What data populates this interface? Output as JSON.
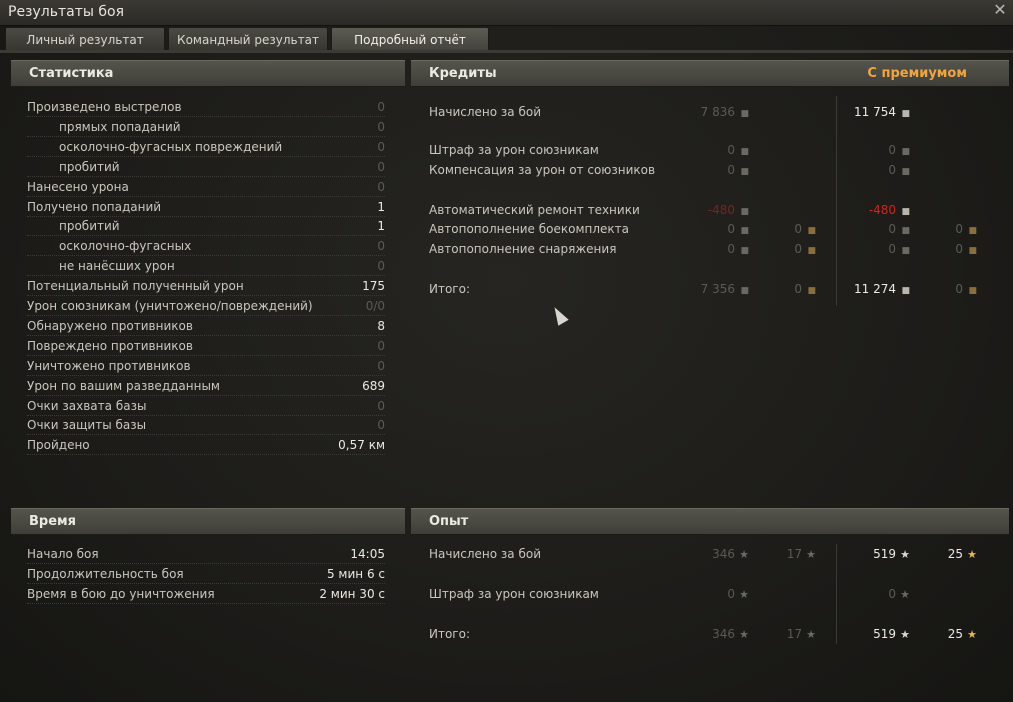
{
  "window": {
    "title": "Результаты боя"
  },
  "tabs": [
    "Личный результат",
    "Командный результат",
    "Подробный отчёт"
  ],
  "stats": {
    "header": "Статистика",
    "rows": [
      {
        "label": "Произведено выстрелов",
        "value": "0",
        "indent": false,
        "dim": true
      },
      {
        "label": "прямых попаданий",
        "value": "0",
        "indent": true,
        "dim": true
      },
      {
        "label": "осколочно-фугасных повреждений",
        "value": "0",
        "indent": true,
        "dim": true
      },
      {
        "label": "пробитий",
        "value": "0",
        "indent": true,
        "dim": true
      },
      {
        "label": "Нанесено урона",
        "value": "0",
        "indent": false,
        "dim": true
      },
      {
        "label": "Получено попаданий",
        "value": "1",
        "indent": false,
        "dim": false
      },
      {
        "label": "пробитий",
        "value": "1",
        "indent": true,
        "dim": false
      },
      {
        "label": "осколочно-фугасных",
        "value": "0",
        "indent": true,
        "dim": true
      },
      {
        "label": "не нанёсших урон",
        "value": "0",
        "indent": true,
        "dim": true
      },
      {
        "label": "Потенциальный полученный урон",
        "value": "175",
        "indent": false,
        "dim": false
      },
      {
        "label": "Урон союзникам (уничтожено/повреждений)",
        "value": "0/0",
        "indent": false,
        "dim": true
      },
      {
        "label": "Обнаружено противников",
        "value": "8",
        "indent": false,
        "dim": false
      },
      {
        "label": "Повреждено противников",
        "value": "0",
        "indent": false,
        "dim": true
      },
      {
        "label": "Уничтожено противников",
        "value": "0",
        "indent": false,
        "dim": true
      },
      {
        "label": "Урон по вашим разведданным",
        "value": "689",
        "indent": false,
        "dim": false
      },
      {
        "label": "Очки захвата базы",
        "value": "0",
        "indent": false,
        "dim": true
      },
      {
        "label": "Очки защиты базы",
        "value": "0",
        "indent": false,
        "dim": true
      },
      {
        "label": "Пройдено",
        "value": "0,57 км",
        "indent": false,
        "dim": false
      }
    ]
  },
  "credits": {
    "header": "Кредиты",
    "premium_label": "С премиумом",
    "rows": [
      {
        "label": "Начислено за бой",
        "std": "7 836",
        "std_gold": "",
        "prem": "11 754",
        "prem_gold": "",
        "style": "normal",
        "prem_bright": true,
        "std_red": false
      },
      {
        "label": "Штраф за урон союзникам",
        "std": "0",
        "std_gold": "",
        "prem": "0",
        "prem_gold": "",
        "style": "normal",
        "prem_bright": false,
        "std_red": false
      },
      {
        "label": "Компенсация за урон от союзников",
        "std": "0",
        "std_gold": "",
        "prem": "0",
        "prem_gold": "",
        "style": "normal",
        "prem_bright": false,
        "std_red": false
      },
      {
        "label": "Автоматический ремонт техники",
        "std": "-480",
        "std_gold": "",
        "prem": "-480",
        "prem_gold": "",
        "style": "red",
        "prem_bright": false,
        "std_red": true
      },
      {
        "label": "Автопополнение боекомплекта",
        "std": "0",
        "std_gold": "0",
        "prem": "0",
        "prem_gold": "0",
        "style": "normal",
        "prem_bright": false,
        "std_red": false
      },
      {
        "label": "Автопополнение снаряжения",
        "std": "0",
        "std_gold": "0",
        "prem": "0",
        "prem_gold": "0",
        "style": "normal",
        "prem_bright": false,
        "std_red": false
      },
      {
        "label": "Итого:",
        "std": "7 356",
        "std_gold": "0",
        "prem": "11 274",
        "prem_gold": "0",
        "style": "normal",
        "prem_bright": true,
        "std_red": false
      }
    ]
  },
  "time": {
    "header": "Время",
    "rows": [
      {
        "label": "Начало боя",
        "value": "14:05"
      },
      {
        "label": "Продолжительность боя",
        "value": "5 мин 6 с"
      },
      {
        "label": "Время в бою до уничтожения",
        "value": "2 мин 30 с"
      }
    ]
  },
  "xp": {
    "header": "Опыт",
    "rows": [
      {
        "label": "Начислено за бой",
        "std": "346",
        "std_free": "17",
        "prem": "519",
        "prem_free": "25"
      },
      {
        "label": "Штраф за урон союзникам",
        "std": "0",
        "std_free": "",
        "prem": "0",
        "prem_free": ""
      },
      {
        "label": "Итого:",
        "std": "346",
        "std_free": "17",
        "prem": "519",
        "prem_free": "25"
      }
    ]
  },
  "colors": {
    "premium": "#f0a540",
    "negative": "#d2241c",
    "gold_star": "#e3b555"
  },
  "icons": {
    "credit": "credit-coin-icon",
    "gold": "gold-coin-icon",
    "xp": "xp-star-icon",
    "free_xp": "free-xp-star-icon",
    "close": "close-icon"
  }
}
